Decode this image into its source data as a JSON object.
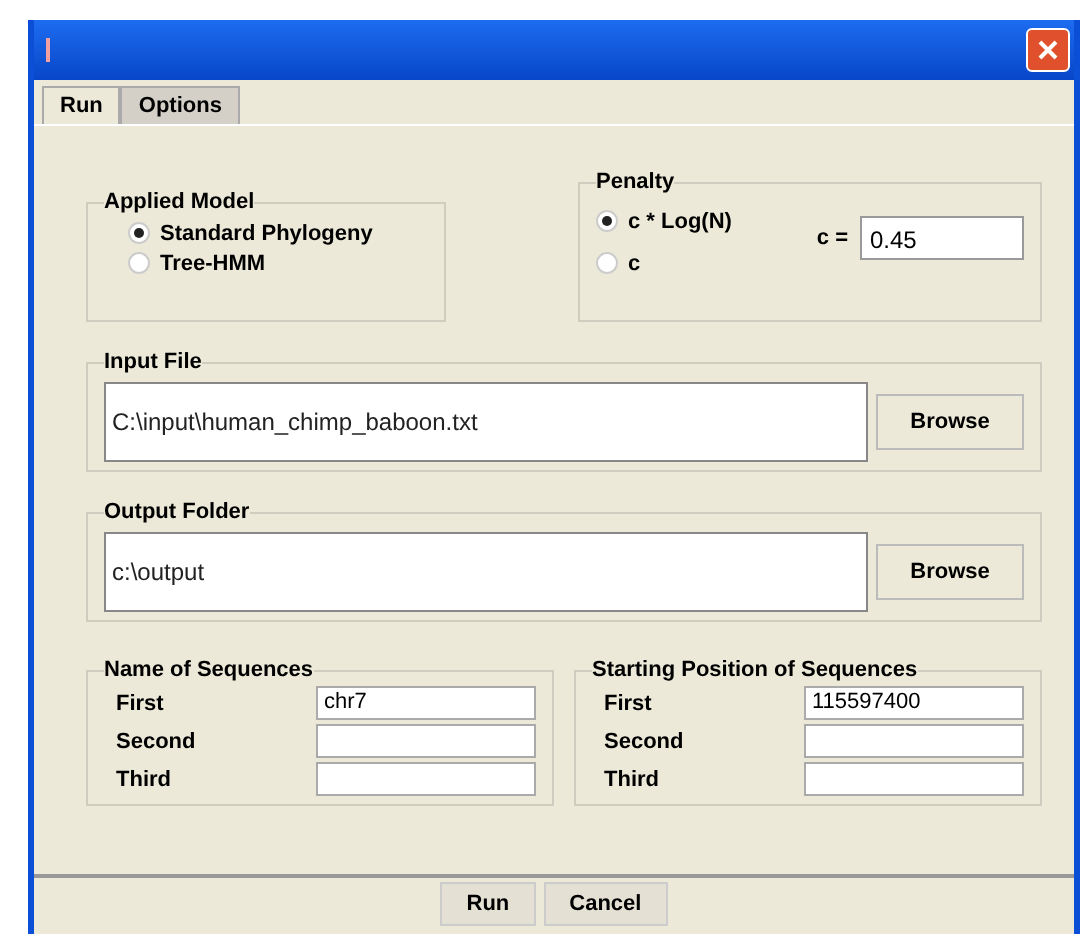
{
  "tabs": [
    {
      "label": "Run",
      "selected": true
    },
    {
      "label": "Options",
      "selected": false
    }
  ],
  "applied_model": {
    "title": "Applied Model",
    "options": [
      {
        "label": "Standard Phylogeny",
        "selected": true
      },
      {
        "label": "Tree-HMM",
        "selected": false
      }
    ]
  },
  "penalty": {
    "title": "Penalty",
    "options": [
      {
        "label": "c * Log(N)",
        "selected": true
      },
      {
        "label": "c",
        "selected": false
      }
    ],
    "c_label": "c =",
    "c_value": "0.45"
  },
  "input_file": {
    "title": "Input File",
    "value": "C:\\input\\human_chimp_baboon.txt",
    "button": "Browse"
  },
  "output_folder": {
    "title": "Output Folder",
    "value": "c:\\output",
    "button": "Browse"
  },
  "name_of_sequences": {
    "title": "Name of Sequences",
    "rows": [
      {
        "label": "First",
        "value": "chr7"
      },
      {
        "label": "Second"
      },
      {
        "label": "Third"
      }
    ]
  },
  "starting_position": {
    "title": "Starting Position of Sequences",
    "rows": [
      {
        "label": "First",
        "value": "115597400"
      },
      {
        "label": "Second"
      },
      {
        "label": "Third"
      }
    ]
  },
  "buttons": [
    "Run",
    "Cancel"
  ]
}
